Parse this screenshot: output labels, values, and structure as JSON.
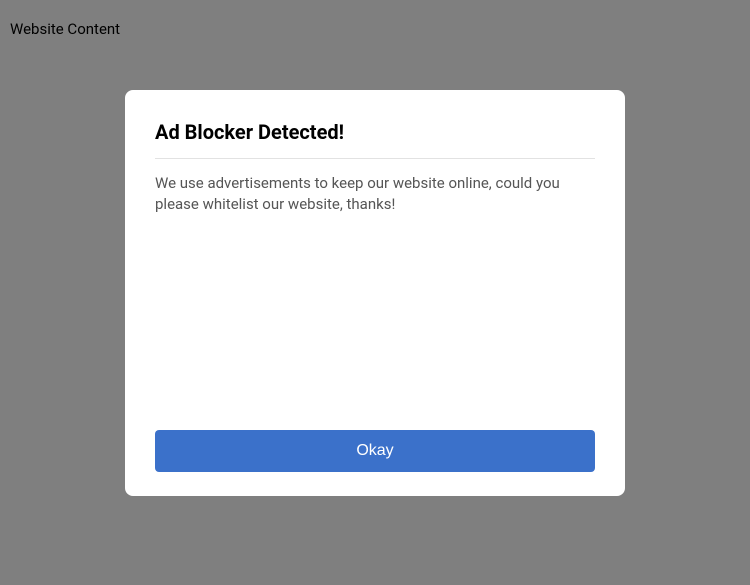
{
  "page": {
    "content_label": "Website Content"
  },
  "modal": {
    "title": "Ad Blocker Detected!",
    "body": "We use advertisements to keep our website online, could you please whitelist our website, thanks!",
    "okay_label": "Okay"
  },
  "colors": {
    "primary": "#3b71ca",
    "overlay": "rgba(0,0,0,0.5)"
  }
}
